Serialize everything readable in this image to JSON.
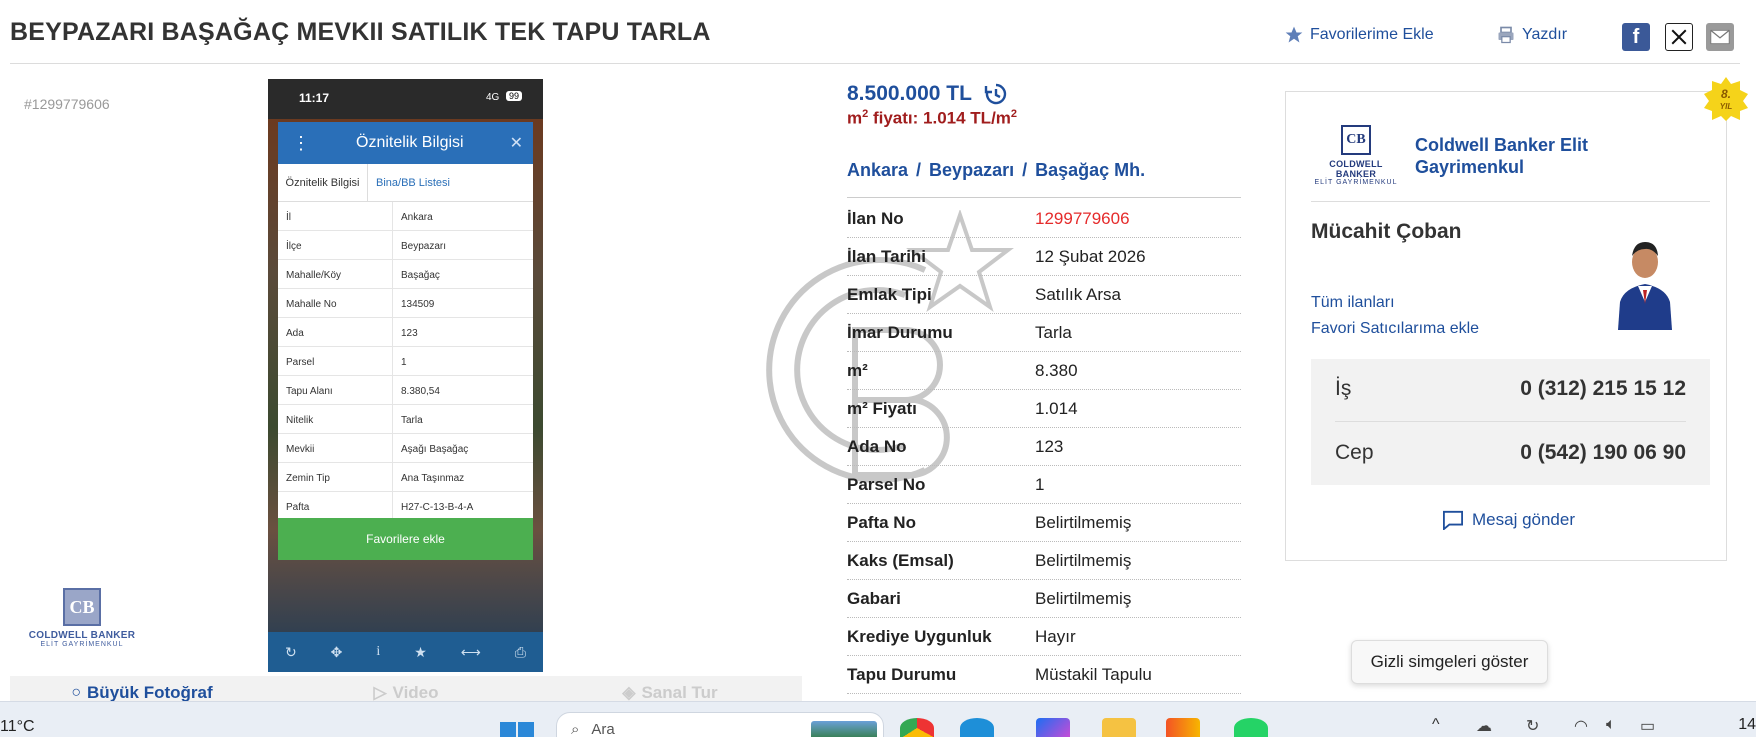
{
  "header": {
    "title": "BEYPAZARI BAŞAĞAÇ MEVKII SATILIK TEK TAPU TARLA",
    "favorite_label": "Favorilerime Ekle",
    "print_label": "Yazdır",
    "share": [
      "facebook-icon",
      "x-icon",
      "mail-icon"
    ]
  },
  "listing": {
    "id_display": "#1299779606",
    "price": "8.500.000 TL",
    "price_m2_prefix": "m",
    "price_m2_exp": "2",
    "price_m2_text": " fiyatı: 1.014 TL/m",
    "price_m2_exp2": "2",
    "breadcrumb": [
      "Ankara",
      "Beypazarı",
      "Başağaç Mh."
    ],
    "details": [
      {
        "key": "İlan No",
        "value": "1299779606",
        "highlight": true
      },
      {
        "key": "İlan Tarihi",
        "value": "12 Şubat 2026"
      },
      {
        "key": "Emlak Tipi",
        "value": "Satılık Arsa"
      },
      {
        "key": "İmar Durumu",
        "value": "Tarla"
      },
      {
        "key": "m²",
        "value": "8.380"
      },
      {
        "key": "m² Fiyatı",
        "value": "1.014"
      },
      {
        "key": "Ada No",
        "value": "123"
      },
      {
        "key": "Parsel No",
        "value": "1"
      },
      {
        "key": "Pafta No",
        "value": "Belirtilmemiş"
      },
      {
        "key": "Kaks (Emsal)",
        "value": "Belirtilmemiş"
      },
      {
        "key": "Gabari",
        "value": "Belirtilmemiş"
      },
      {
        "key": "Krediye Uygunluk",
        "value": "Hayır"
      },
      {
        "key": "Tapu Durumu",
        "value": "Müstakil Tapulu"
      }
    ]
  },
  "left_logo": {
    "mark": "CB",
    "name": "COLDWELL BANKER",
    "sub": "ELİT GAYRİMENKUL"
  },
  "phone_shot": {
    "time": "11:17",
    "network": "4G",
    "battery": "99",
    "popup_title": "Öznitelik Bilgisi",
    "tabs": [
      "Öznitelik Bilgisi",
      "Bina/BB Listesi"
    ],
    "rows": [
      {
        "k": "İl",
        "v": "Ankara"
      },
      {
        "k": "İlçe",
        "v": "Beypazarı"
      },
      {
        "k": "Mahalle/Köy",
        "v": "Başağaç"
      },
      {
        "k": "Mahalle No",
        "v": "134509"
      },
      {
        "k": "Ada",
        "v": "123"
      },
      {
        "k": "Parsel",
        "v": "1"
      },
      {
        "k": "Tapu Alanı",
        "v": "8.380,54"
      },
      {
        "k": "Nitelik",
        "v": "Tarla"
      },
      {
        "k": "Mevkii",
        "v": "Aşağı Başağaç"
      },
      {
        "k": "Zemin Tip",
        "v": "Ana Taşınmaz"
      },
      {
        "k": "Pafta",
        "v": "H27-C-13-B-4-A"
      }
    ],
    "button": "Favorilere ekle"
  },
  "media_tabs": [
    "Büyük Fotoğraf",
    "Video",
    "Sanal Tur"
  ],
  "seller": {
    "badge_line1": "8.",
    "badge_line2": "YIL",
    "company_logo_mark": "CB",
    "company_logo_name": "COLDWELL BANKER",
    "company_logo_sub": "ELİT GAYRİMENKUL",
    "company_name": "Coldwell Banker Elit Gayrimenkul",
    "agent_name": "Mücahit Çoban",
    "all_listings": "Tüm ilanları",
    "add_fav_seller": "Favori Satıcılarıma ekle",
    "phones": [
      {
        "label": "İş",
        "number": "0 (312) 215 15 12"
      },
      {
        "label": "Cep",
        "number": "0 (542) 190 06 90"
      }
    ],
    "send_message": "Mesaj gönder"
  },
  "tooltip": "Gizli simgeleri göster",
  "taskbar": {
    "weather": "11°C",
    "search_placeholder": "Ara",
    "clock": "14"
  },
  "colors": {
    "link_blue": "#1f4f9c",
    "price_red": "#a01d1d",
    "id_red": "#e52b2b",
    "fav_green": "#4caf50"
  }
}
